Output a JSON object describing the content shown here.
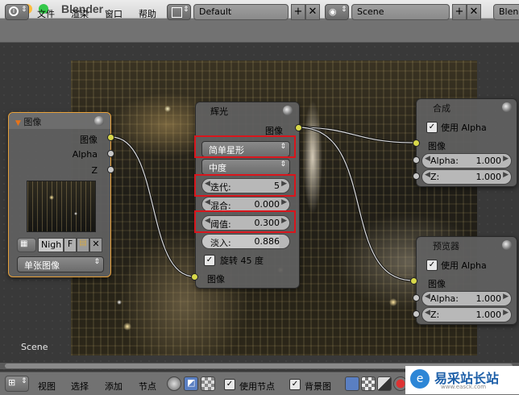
{
  "window": {
    "title": "Blender"
  },
  "header": {
    "menus": [
      "文件",
      "渲染",
      "窗口",
      "帮助"
    ],
    "layout_field": "Default",
    "scene_field": "Scene",
    "engine_field": "Blender"
  },
  "canvas": {
    "scene_label": "Scene"
  },
  "nodes": {
    "image": {
      "title": "图像",
      "outputs": [
        "图像",
        "Alpha",
        "Z"
      ],
      "image_name": "Nigh",
      "f_label": "F",
      "source": "单张图像"
    },
    "glare": {
      "title": "辉光",
      "input_label": "图像",
      "type": "简单星形",
      "quality": "中度",
      "iterations": {
        "label": "迭代:",
        "value": "5"
      },
      "mix": {
        "label": "混合:",
        "value": "0.000"
      },
      "threshold": {
        "label": "阈值:",
        "value": "0.300"
      },
      "fade": {
        "label": "淡入:",
        "value": "0.886"
      },
      "rotate45": {
        "label": "旋转 45 度",
        "checked": true
      },
      "output_label": "图像"
    },
    "composite": {
      "title": "合成",
      "use_alpha": "使用 Alpha",
      "input_image": "图像",
      "alpha": {
        "label": "Alpha:",
        "value": "1.000"
      },
      "z": {
        "label": "Z:",
        "value": "1.000"
      }
    },
    "viewer": {
      "title": "预览器",
      "use_alpha": "使用 Alpha",
      "input_image": "图像",
      "alpha": {
        "label": "Alpha:",
        "value": "1.000"
      },
      "z": {
        "label": "Z:",
        "value": "1.000"
      }
    }
  },
  "footer": {
    "menus": [
      "视图",
      "选择",
      "添加",
      "节点"
    ],
    "use_nodes": "使用节点",
    "backdrop": "背景图",
    "watermark": "易采站长站",
    "watermark_sub": "www.easck.com"
  },
  "colors": {
    "highlight": "#d9151c",
    "socket_yellow": "#d8d84a",
    "socket_gray": "#c8c8c8"
  }
}
